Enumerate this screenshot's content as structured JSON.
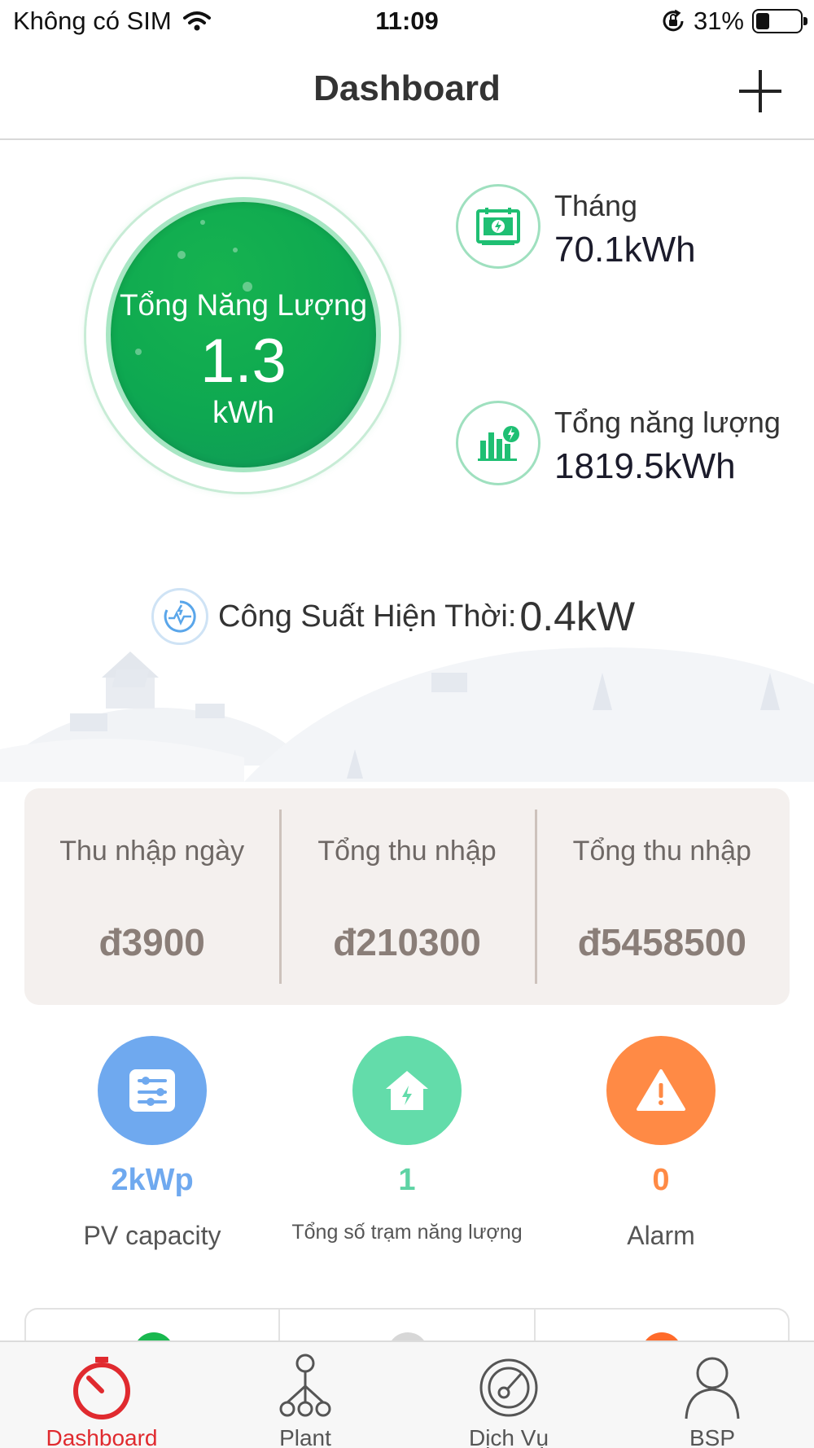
{
  "status_bar": {
    "carrier": "Không có SIM",
    "time": "11:09",
    "battery_percent": "31%",
    "battery_level": 0.31
  },
  "nav": {
    "title": "Dashboard",
    "add_icon": "plus-icon"
  },
  "energy_circle": {
    "label": "Tổng Năng Lượng",
    "value": "1.3",
    "unit": "kWh"
  },
  "stats": {
    "month_label": "Tháng",
    "month_value": "70.1kWh",
    "month_icon": "calendar-energy-icon",
    "total_label": "Tổng năng lượng",
    "total_value": "1819.5kWh",
    "total_icon": "bar-chart-energy-icon"
  },
  "current_power": {
    "label": "Công Suất Hiện Thời:",
    "value": "0.4kW",
    "icon": "power-gauge-icon"
  },
  "income": [
    {
      "label": "Thu nhập ngày",
      "value": "đ3900"
    },
    {
      "label": "Tổng thu nhập",
      "value": "đ210300"
    },
    {
      "label": "Tổng thu nhập",
      "value": "đ5458500"
    }
  ],
  "summary": [
    {
      "value": "2kWp",
      "label": "PV capacity",
      "icon": "sliders-icon",
      "color": "#6fa9ef",
      "value_color": "#6fa9ef"
    },
    {
      "value": "1",
      "label": "Tổng số trạm năng lượng",
      "icon": "house-bolt-icon",
      "color": "#63dcaa",
      "value_color": "#5ed3a4"
    },
    {
      "value": "0",
      "label": "Alarm",
      "icon": "warning-icon",
      "color": "#ff8a45",
      "value_color": "#ff8a45"
    }
  ],
  "tabs": [
    {
      "label": "Dashboard",
      "icon": "dashboard-gauge-icon",
      "active": true
    },
    {
      "label": "Plant",
      "icon": "hierarchy-icon",
      "active": false
    },
    {
      "label": "Dịch Vụ",
      "icon": "service-icon",
      "active": false
    },
    {
      "label": "BSP",
      "icon": "user-icon",
      "active": false
    }
  ],
  "colors": {
    "accent_green": "#0ea851",
    "tab_active": "#e02a2f"
  }
}
